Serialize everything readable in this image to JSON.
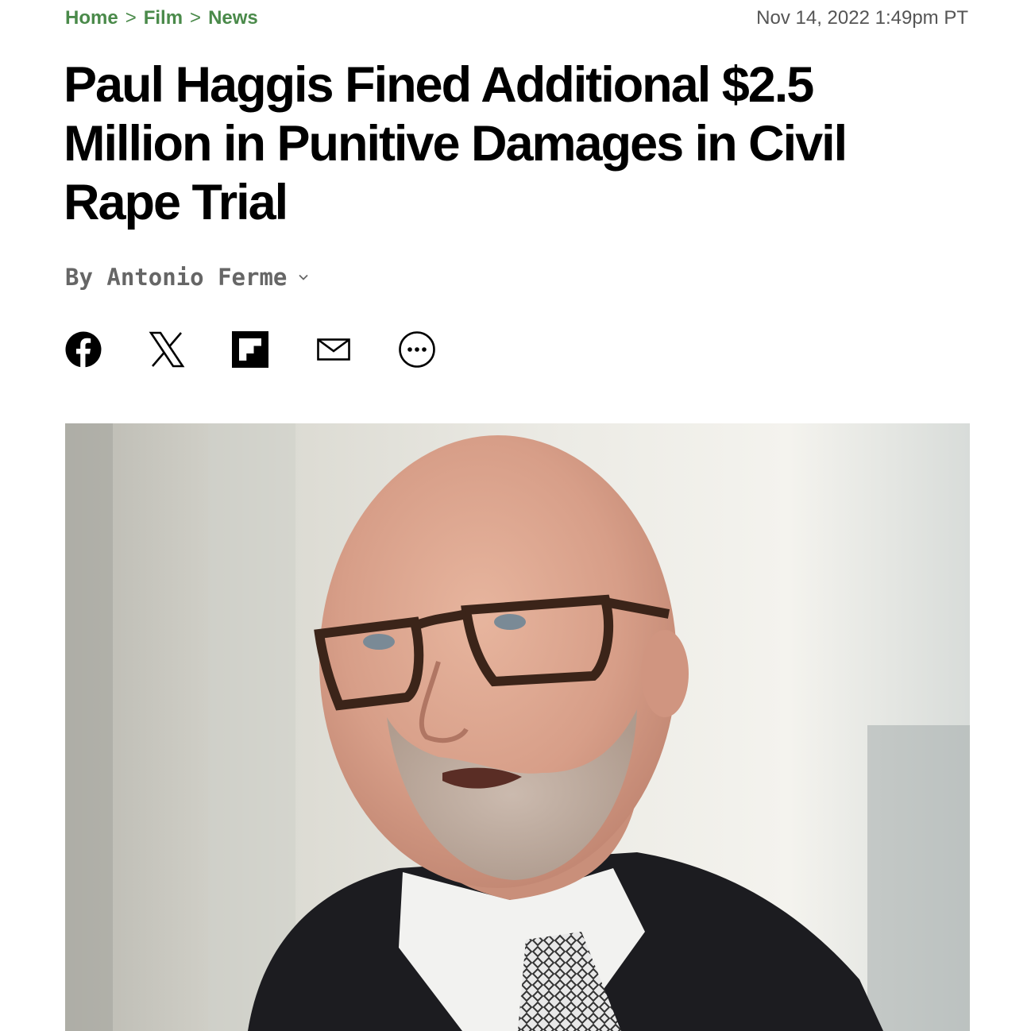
{
  "breadcrumb": {
    "items": [
      "Home",
      "Film",
      "News"
    ],
    "separator": ">"
  },
  "timestamp": "Nov 14, 2022 1:49pm PT",
  "headline": "Paul Haggis Fined Additional $2.5 Million in Punitive Damages in Civil Rape Trial",
  "byline": {
    "prefix": "By",
    "author": "Antonio Ferme"
  },
  "share": {
    "icons": [
      "facebook-icon",
      "x-icon",
      "flipboard-icon",
      "email-icon",
      "more-icon"
    ]
  },
  "colors": {
    "breadcrumb": "#4a8a4a",
    "headline": "#000000",
    "byline": "#666666"
  }
}
